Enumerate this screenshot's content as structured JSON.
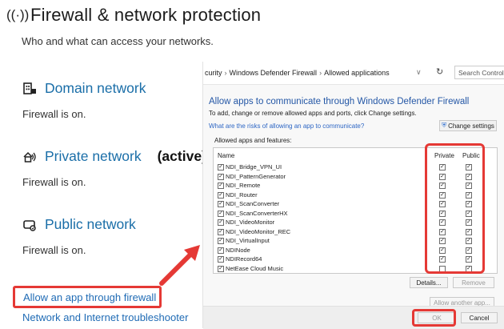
{
  "header": {
    "icon": "wifi-antenna-icon",
    "glyph": "((·))",
    "title": "Firewall & network protection"
  },
  "subtitle": "Who and what can access your networks.",
  "networks": [
    {
      "icon": "domain-network-icon",
      "name": "Domain network",
      "active_label": "",
      "status": "Firewall is on."
    },
    {
      "icon": "private-network-icon",
      "name": "Private network",
      "active_label": "(active)",
      "status": "Firewall is on."
    },
    {
      "icon": "public-network-icon",
      "name": "Public network",
      "active_label": "",
      "status": "Firewall is on."
    }
  ],
  "links": {
    "allow_app": "Allow an app through firewall",
    "troubleshooter": "Network and Internet troubleshooter"
  },
  "control_panel": {
    "breadcrumb": [
      "curity",
      "Windows Defender Firewall",
      "Allowed applications"
    ],
    "dropdown_glyph": "∨",
    "refresh_glyph": "↻",
    "search_placeholder": "Search Control Panel",
    "title": "Allow apps to communicate through Windows Defender Firewall",
    "subtitle": "To add, change or remove allowed apps and ports, click Change settings.",
    "risks_link": "What are the risks of allowing an app to communicate?",
    "change_settings": "Change settings",
    "allowed_label": "Allowed apps and features:",
    "columns": {
      "name": "Name",
      "private": "Private",
      "public": "Public"
    },
    "apps": [
      {
        "name": "NDI_Bridge_VPN_UI",
        "enabled": true,
        "private": true,
        "public": true
      },
      {
        "name": "NDI_PatternGenerator",
        "enabled": true,
        "private": true,
        "public": true
      },
      {
        "name": "NDI_Remote",
        "enabled": true,
        "private": true,
        "public": true
      },
      {
        "name": "NDI_Router",
        "enabled": true,
        "private": true,
        "public": true
      },
      {
        "name": "NDI_ScanConverter",
        "enabled": true,
        "private": true,
        "public": true
      },
      {
        "name": "NDI_ScanConverterHX",
        "enabled": true,
        "private": true,
        "public": true
      },
      {
        "name": "NDI_VideoMonitor",
        "enabled": true,
        "private": true,
        "public": true
      },
      {
        "name": "NDI_VideoMonitor_REC",
        "enabled": true,
        "private": true,
        "public": true
      },
      {
        "name": "NDI_VirtualInput",
        "enabled": true,
        "private": true,
        "public": true
      },
      {
        "name": "NDINode",
        "enabled": true,
        "private": true,
        "public": true
      },
      {
        "name": "NDIRecord64",
        "enabled": true,
        "private": true,
        "public": true
      },
      {
        "name": "NetEase Cloud Music",
        "enabled": true,
        "private": false,
        "public": true
      }
    ],
    "details_button": "Details...",
    "remove_button": "Remove",
    "allow_another": "Allow another app...",
    "ok_button": "OK",
    "cancel_button": "Cancel"
  },
  "colors": {
    "accent_link": "#1f6bb5",
    "highlight_red": "#e53935",
    "title_blue": "#2457a6"
  }
}
